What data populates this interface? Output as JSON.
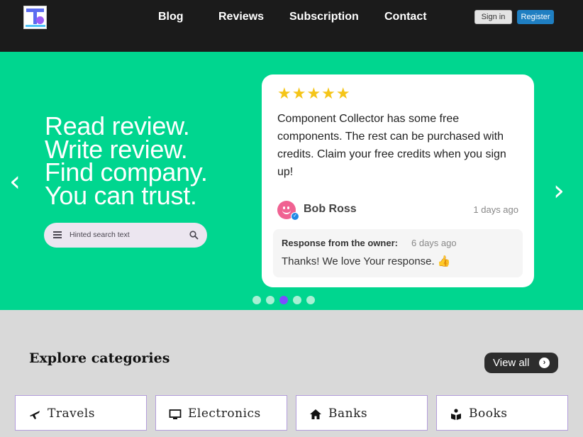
{
  "header": {
    "nav": [
      "Blog",
      "Reviews",
      "Subscription",
      "Contact"
    ],
    "signin_label": "Sign in",
    "register_label": "Register"
  },
  "hero": {
    "tagline": [
      "Read review.",
      "Write review.",
      "Find company.",
      "You can trust."
    ],
    "search_placeholder": "Hinted search text",
    "prev_arrow": "‹",
    "next_arrow": "›"
  },
  "review_card": {
    "rating": 5,
    "stars": "★★★★★",
    "text": "Component Collector has some free components. The rest can be purchased with credits. Claim your free credits when you sign up!",
    "author": "Bob Ross",
    "date": "1 days ago",
    "response_label": "Response from the owner:",
    "response_date": "6 days ago",
    "response_text": "Thanks!  We love Your response. 👍"
  },
  "carousel": {
    "total_slides": 5,
    "active_index": 2
  },
  "categories": {
    "title": "Explore categories",
    "view_all_label": "View all",
    "items": [
      {
        "label": "Travels",
        "icon": "airplane-icon"
      },
      {
        "label": "Electronics",
        "icon": "monitor-icon"
      },
      {
        "label": "Banks",
        "icon": "home-icon"
      },
      {
        "label": "Books",
        "icon": "book-reader-icon"
      }
    ]
  },
  "colors": {
    "header_bg": "#1b1b1b",
    "hero_bg": "#00d68f",
    "register_bg": "#1f7fc2",
    "active_dot": "#7c4dff",
    "category_border": "#b39ddb"
  }
}
